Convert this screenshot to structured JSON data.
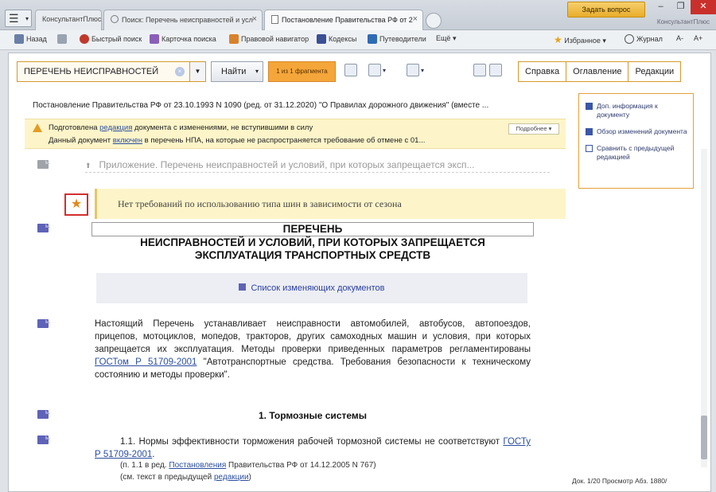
{
  "tabs": [
    {
      "label": "КонсультантПлюс"
    },
    {
      "label": "Поиск: Перечень неисправностей и усл"
    },
    {
      "label": "Постановление Правительства РФ от 2"
    }
  ],
  "header": {
    "ask_button": "Задать вопрос",
    "brand": "КонсультантПлюс"
  },
  "toolbar": {
    "back": "Назад",
    "quick_search": "Быстрый поиск",
    "card_search": "Карточка поиска",
    "legal_navigator": "Правовой навигатор",
    "codes": "Кодексы",
    "reference": "Путеводители",
    "more": "Ещё",
    "favorites": "Избранное",
    "history": "Журнал"
  },
  "search": {
    "value": "ПЕРЕЧЕНЬ НЕИСПРАВНОСТЕЙ",
    "find_button": "Найти",
    "found_label": "1 из 1 фрагмента"
  },
  "right_tabs": [
    "Справка",
    "Оглавление",
    "Редакции"
  ],
  "document": {
    "title": "Постановление Правительства РФ от 23.10.1993 N 1090 (ред. от 31.12.2020) \"О Правилах дорожного движения\" (вместе ...",
    "warning_line1_a": "Подготовлена ",
    "warning_line1_link": "редакция",
    "warning_line1_b": " документа с изменениями, не вступившими в силу",
    "warning_line2_a": "Данный документ ",
    "warning_line2_link": "включен",
    "warning_line2_b": " в перечень НПА, на которые не распространяется требование об отмене с 01...",
    "more_button": "Подробнее ▾",
    "appendix": "Приложение. Перечень неисправностей и условий, при которых запрещается эксп...",
    "note": "Нет требований по использованию типа шин в зависимости от сезона",
    "heading_1": "ПЕРЕЧЕНЬ",
    "heading_2": "НЕИСПРАВНОСТЕЙ И УСЛОВИЙ, ПРИ КОТОРЫХ ЗАПРЕЩАЕТСЯ",
    "heading_3": "ЭКСПЛУАТАЦИЯ ТРАНСПОРТНЫХ СРЕДСТВ",
    "changes_link": "Список изменяющих документов",
    "para1_a": "Настоящий Перечень устанавливает неисправности автомобилей, автобусов, автопоездов, прицепов, мотоциклов, мопедов, тракторов, других самоходных машин и условия, при которых запрещается их эксплуатация. Методы проверки приведенных параметров регламентированы ",
    "para1_link": "ГОСТом Р 51709-2001",
    "para1_b": " \"Автотранспортные средства. Требования безопасности к техническому состоянию и методы проверки\".",
    "section1": "1. Тормозные системы",
    "para2_a": "1.1. Нормы эффективности торможения рабочей тормозной системы не соответствуют ",
    "para2_link": "ГОСТу Р 51709-2001",
    "para2_b": ".",
    "small1_a": "(п. 1.1 в ред. ",
    "small1_link": "Постановления",
    "small1_b": " Правительства РФ от 14.12.2005 N 767)",
    "small2_a": "(см. текст в предыдущей ",
    "small2_link": "редакции",
    "small2_b": ")"
  },
  "sidepanel": [
    {
      "label": "Доп. информация к документу"
    },
    {
      "label": "Обзор изменений документа"
    },
    {
      "label": "Сравнить с предыдущей редакцией"
    }
  ],
  "status": "Док. 1/20 Просмотр Абз. 1880/"
}
